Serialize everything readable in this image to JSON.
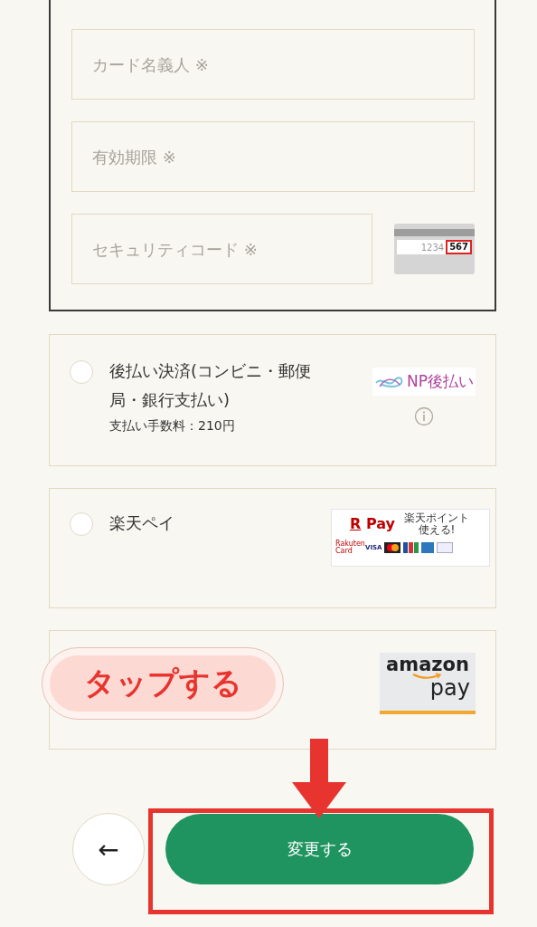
{
  "card_form": {
    "fields": [
      {
        "placeholder": "カード名義人 ※"
      },
      {
        "placeholder": "有効期限 ※"
      },
      {
        "placeholder": "セキュリティコード ※"
      }
    ],
    "card_sample": {
      "digits": "1234",
      "code": "567"
    }
  },
  "payment_options": [
    {
      "kind": "np",
      "title": "後払い決済(コンビニ・郵便局・銀行支払い)",
      "fee": "支払い手数料：210円",
      "selected": false,
      "logo": "NP後払い"
    },
    {
      "kind": "rpay",
      "title": "楽天ペイ",
      "selected": false,
      "logo_mark": "R",
      "logo_brand": "Pay",
      "logo_tagline": "楽天ポイント使える!",
      "logo_cards": [
        "Rakuten Card",
        "VISA"
      ]
    },
    {
      "kind": "amazon",
      "logo_top": "amazon",
      "logo_bottom": "pay"
    }
  ],
  "annotation": {
    "callout": "タップする"
  },
  "buttons": {
    "back": "←",
    "submit": "変更する"
  }
}
